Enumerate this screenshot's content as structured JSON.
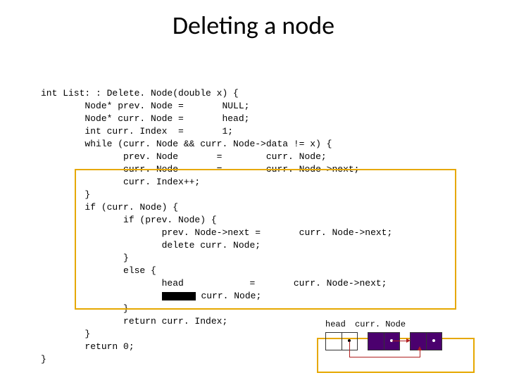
{
  "title": "Deleting a node",
  "code": {
    "l01": "int List: : Delete. Node(double x) {",
    "l02": "        Node* prev. Node =       NULL;",
    "l03": "        Node* curr. Node =       head;",
    "l04": "        int curr. Index  =       1;",
    "l05": "        while (curr. Node && curr. Node->data != x) {",
    "l06": "               prev. Node       =        curr. Node;",
    "l07": "               curr. Node       =        curr. Node->next;",
    "l08": "               curr. Index++;",
    "l09": "        }",
    "l10": "        if (curr. Node) {",
    "l11": "               if (prev. Node) {",
    "l12": "                      prev. Node->next =       curr. Node->next;",
    "l13": "                      delete curr. Node;",
    "l14": "               }",
    "l15": "               else {",
    "l16a": "                      head            =       curr. Node->next;",
    "l17a": "                      ",
    "l17b": " curr. Node;",
    "l18": "               }",
    "l19": "               return curr. Index;",
    "l20": "        }",
    "l21": "        return 0;",
    "l22": "}"
  },
  "diagram": {
    "label_head": "head",
    "label_curr": "curr. Node"
  }
}
